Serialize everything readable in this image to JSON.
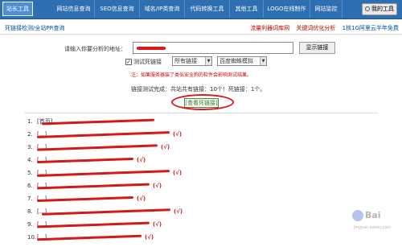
{
  "nav": {
    "items": [
      "站长工具",
      "网站信息查询",
      "SEO信息查询",
      "域名/IP类查询",
      "代码转换工具",
      "其他工具",
      "LOGO在线制作",
      "网站监控"
    ],
    "mytools": "我的工具"
  },
  "subbar": {
    "title": "死链接检测/全站PR查询",
    "links": [
      "流量利器词库网",
      "关键词优化分析",
      "1核1G阿里云半年免费"
    ]
  },
  "form": {
    "url_label": "请输入你要分析的地址：",
    "url_value": "",
    "show_button": "显示链接",
    "checkbox_label": "测试死链接",
    "checkbox_checked": "✓",
    "select1": "所有链接",
    "select2": "百度蜘蛛模拟",
    "note": "注：如果服务器装了类似安全狗的软件会影响测试结果。",
    "summary": "链接测试完成：共站共有链接：10个！死链接：1个。",
    "view_dead": "[查看死链接]"
  },
  "results": [
    {
      "n": "1.",
      "text": "[首页]"
    },
    {
      "n": "2.",
      "text": "[...]",
      "suffix": "(√)"
    },
    {
      "n": "3.",
      "text": "[...]",
      "suffix": "(√)"
    },
    {
      "n": "4.",
      "text": "[...]",
      "suffix": "(√)"
    },
    {
      "n": "5.",
      "text": "[...]",
      "suffix": "(√)"
    },
    {
      "n": "6.",
      "text": "[...]",
      "suffix": "(√)"
    },
    {
      "n": "7.",
      "text": "[...]",
      "suffix": "(√)"
    },
    {
      "n": "8.",
      "text": "[...]",
      "suffix": "(√)"
    },
    {
      "n": "9.",
      "text": "[...]",
      "suffix": "(√)"
    },
    {
      "n": "10.",
      "text": "[...]",
      "suffix": "(√)"
    }
  ],
  "watermark": {
    "main": "Bai",
    "sub": "jingyan.baidu.com"
  },
  "colors": {
    "nav_bg": "#2d6fb0",
    "mark_red": "#d31a1a",
    "accent_green": "#2a7a20"
  }
}
